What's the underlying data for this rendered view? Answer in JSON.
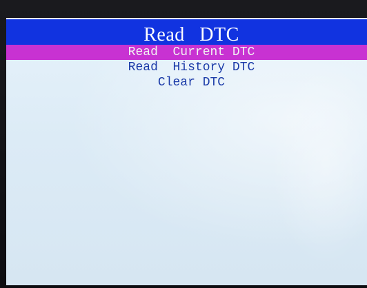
{
  "title": "Read  DTC",
  "menu": {
    "items": [
      {
        "label": "Read  Current DTC",
        "selected": true
      },
      {
        "label": "Read  History DTC",
        "selected": false
      },
      {
        "label": "Clear DTC",
        "selected": false
      }
    ]
  },
  "colors": {
    "title_bar": "#1133e0",
    "selection_highlight": "#c832d2",
    "menu_text": "#1a3aa8",
    "screen_background": "#dcebf6"
  }
}
